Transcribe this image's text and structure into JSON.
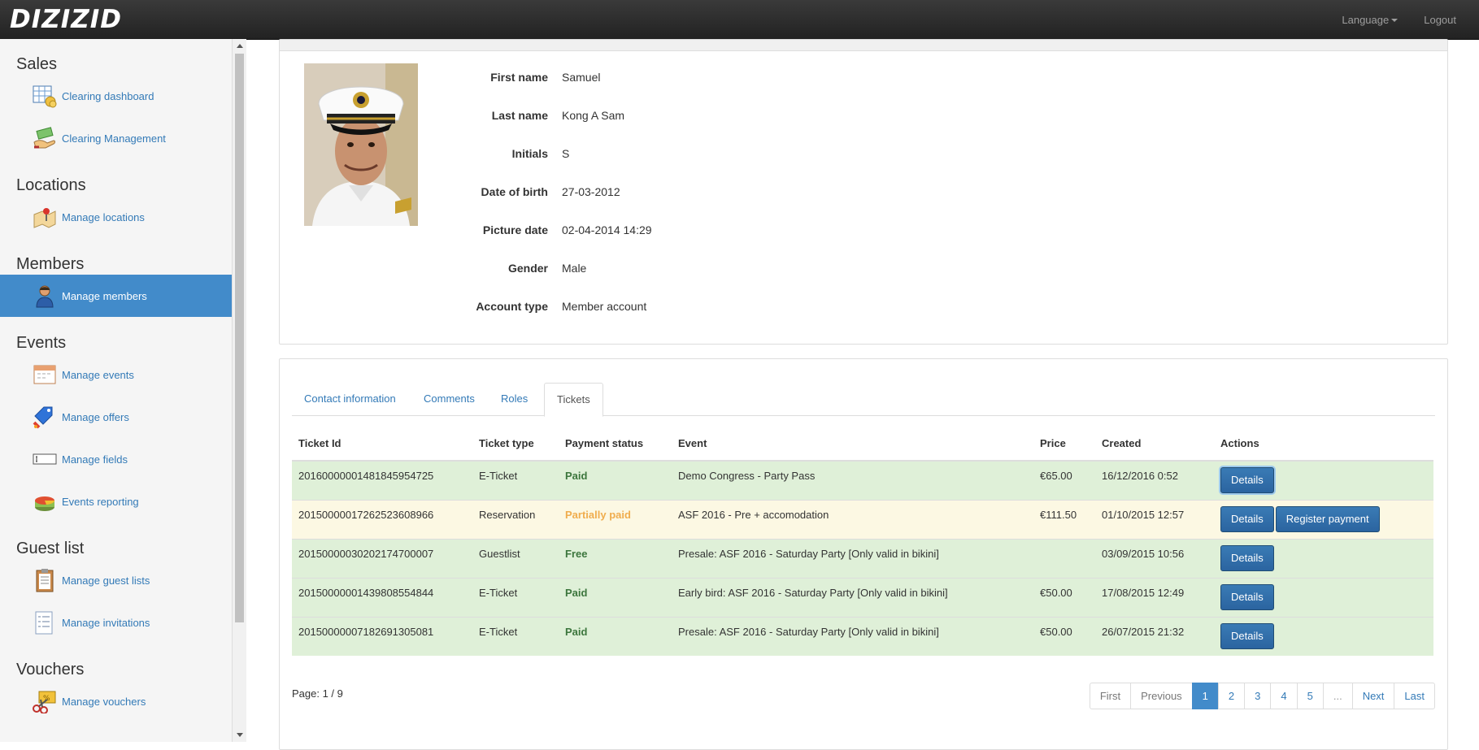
{
  "app": {
    "logo_text": "DIZIZID"
  },
  "topnav": {
    "language_label": "Language",
    "logout_label": "Logout"
  },
  "sidebar": {
    "sections": [
      {
        "title": "Sales",
        "items": [
          {
            "label": "Clearing dashboard",
            "icon": "spreadsheet-coins-icon"
          },
          {
            "label": "Clearing Management",
            "icon": "money-hand-icon"
          }
        ]
      },
      {
        "title": "Locations",
        "items": [
          {
            "label": "Manage locations",
            "icon": "map-pin-icon"
          }
        ]
      },
      {
        "title": "Members",
        "items": [
          {
            "label": "Manage members",
            "icon": "person-icon",
            "active": true
          }
        ]
      },
      {
        "title": "Events",
        "items": [
          {
            "label": "Manage events",
            "icon": "calendar-icon"
          },
          {
            "label": "Manage offers",
            "icon": "price-tag-icon"
          },
          {
            "label": "Manage fields",
            "icon": "text-field-icon"
          },
          {
            "label": "Events reporting",
            "icon": "pie-chart-icon"
          }
        ]
      },
      {
        "title": "Guest list",
        "items": [
          {
            "label": "Manage guest lists",
            "icon": "clipboard-icon"
          },
          {
            "label": "Manage invitations",
            "icon": "checklist-icon"
          }
        ]
      },
      {
        "title": "Vouchers",
        "items": [
          {
            "label": "Manage vouchers",
            "icon": "voucher-scissors-icon"
          }
        ]
      }
    ]
  },
  "member": {
    "fields": [
      {
        "label": "First name",
        "value": "Samuel"
      },
      {
        "label": "Last name",
        "value": "Kong A Sam"
      },
      {
        "label": "Initials",
        "value": "S"
      },
      {
        "label": "Date of birth",
        "value": "27-03-2012"
      },
      {
        "label": "Picture date",
        "value": "02-04-2014 14:29"
      },
      {
        "label": "Gender",
        "value": "Male"
      },
      {
        "label": "Account type",
        "value": "Member account"
      }
    ]
  },
  "tabs": [
    {
      "label": "Contact information"
    },
    {
      "label": "Comments"
    },
    {
      "label": "Roles"
    },
    {
      "label": "Tickets",
      "active": true
    }
  ],
  "tickets": {
    "headers": [
      "Ticket Id",
      "Ticket type",
      "Payment status",
      "Event",
      "Price",
      "Created",
      "Actions"
    ],
    "rows": [
      {
        "id": "20160000001481845954725",
        "type": "E-Ticket",
        "status": "Paid",
        "event": "Demo Congress - Party Pass",
        "price": "€65.00",
        "created": "16/12/2016 0:52",
        "row_class": "success",
        "actions": [
          "Details"
        ]
      },
      {
        "id": "20150000017262523608966",
        "type": "Reservation",
        "status": "Partially paid",
        "event": "ASF 2016 - Pre + accomodation",
        "price": "€111.50",
        "created": "01/10/2015 12:57",
        "row_class": "warning",
        "actions": [
          "Details",
          "Register payment"
        ]
      },
      {
        "id": "20150000030202174700007",
        "type": "Guestlist",
        "status": "Free",
        "event": "Presale: ASF 2016 - Saturday Party [Only valid in bikini]",
        "price": "",
        "created": "03/09/2015 10:56",
        "row_class": "success",
        "actions": [
          "Details"
        ]
      },
      {
        "id": "20150000001439808554844",
        "type": "E-Ticket",
        "status": "Paid",
        "event": "Early bird: ASF 2016 - Saturday Party [Only valid in bikini]",
        "price": "€50.00",
        "created": "17/08/2015 12:49",
        "row_class": "success",
        "actions": [
          "Details"
        ]
      },
      {
        "id": "20150000007182691305081",
        "type": "E-Ticket",
        "status": "Paid",
        "event": "Presale: ASF 2016 - Saturday Party [Only valid in bikini]",
        "price": "€50.00",
        "created": "26/07/2015 21:32",
        "row_class": "success",
        "actions": [
          "Details"
        ]
      }
    ]
  },
  "pagination": {
    "page_label": "Page: 1 / 9",
    "buttons": [
      "First",
      "Previous",
      "1",
      "2",
      "3",
      "4",
      "5",
      "...",
      "Next",
      "Last"
    ],
    "current": "1"
  },
  "colors": {
    "accent": "#428bca",
    "paid": "#3c763d",
    "partial": "#f0ad4e",
    "success_row": "#dff0d8",
    "warning_row": "#fcf8e3"
  }
}
